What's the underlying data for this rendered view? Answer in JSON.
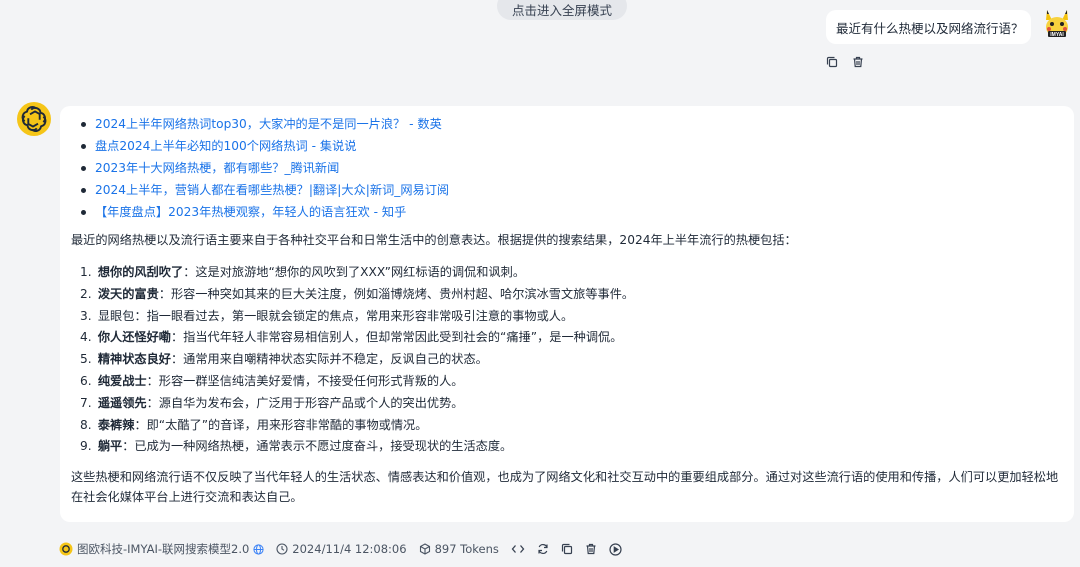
{
  "top": {
    "fullscreen_label": "点击进入全屏模式"
  },
  "user_message": {
    "text": "最近有什么热梗以及网络流行语？"
  },
  "user_avatar": {
    "text": "IMYAI"
  },
  "answer": {
    "references": [
      "2024上半年网络热词top30，大家冲的是不是同一片浪？ - 数英",
      "盘点2024上半年必知的100个网络热词 - 集说说",
      "2023年十大网络热梗，都有哪些？_腾讯新闻",
      "2024上半年，营销人都在看哪些热梗？|翻译|大众|新词_网易订阅",
      "【年度盘点】2023年热梗观察，年轻人的语言狂欢 - 知乎"
    ],
    "intro": "最近的网络热梗以及流行语主要来自于各种社交平台和日常生活中的创意表达。根据提供的搜索结果，2024年上半年流行的热梗包括：",
    "terms": [
      {
        "num": "1.",
        "term": "想你的风刮吹了",
        "desc": "：这是对旅游地“想你的风吹到了XXX”网红标语的调侃和讽刺。"
      },
      {
        "num": "2.",
        "term": "泼天的富贵",
        "desc": "：形容一种突如其来的巨大关注度，例如淄博烧烤、贵州村超、哈尔滨冰雪文旅等事件。"
      },
      {
        "num": "3.",
        "term": "显眼包",
        "desc": "：指一眼看过去，第一眼就会锁定的焦点，常用来形容非常吸引注意的事物或人。"
      },
      {
        "num": "4.",
        "term": "你人还怪好嘞",
        "desc": "：指当代年轻人非常容易相信别人，但却常常因此受到社会的“痛捶”，是一种调侃。"
      },
      {
        "num": "5.",
        "term": "精神状态良好",
        "desc": "：通常用来自嘲精神状态实际并不稳定，反讽自己的状态。"
      },
      {
        "num": "6.",
        "term": "纯爱战士",
        "desc": "：形容一群坚信纯洁美好爱情，不接受任何形式背叛的人。"
      },
      {
        "num": "7.",
        "term": "遥遥领先",
        "desc": "：源自华为发布会，广泛用于形容产品或个人的突出优势。"
      },
      {
        "num": "8.",
        "term": "泰裤辣",
        "desc": "：即“太酷了”的音译，用来形容非常酷的事物或情况。"
      },
      {
        "num": "9.",
        "term": "躺平",
        "desc": "：已成为一种网络热梗，通常表示不愿过度奋斗，接受现状的生活态度。"
      }
    ],
    "summary": "这些热梗和网络流行语不仅反映了当代年轻人的生活状态、情感表达和价值观，也成为了网络文化和社交互动中的重要组成部分。通过对这些流行语的使用和传播，人们可以更加轻松地在社会化媒体平台上进行交流和表达自己。"
  },
  "footer": {
    "model": "图欧科技-IMYAI-联网搜索模型2.0",
    "timestamp": "2024/11/4 12:08:06",
    "tokens": "897 Tokens"
  },
  "colors": {
    "link": "#1a73e8",
    "background": "#f3f4f6",
    "card": "#ffffff"
  }
}
